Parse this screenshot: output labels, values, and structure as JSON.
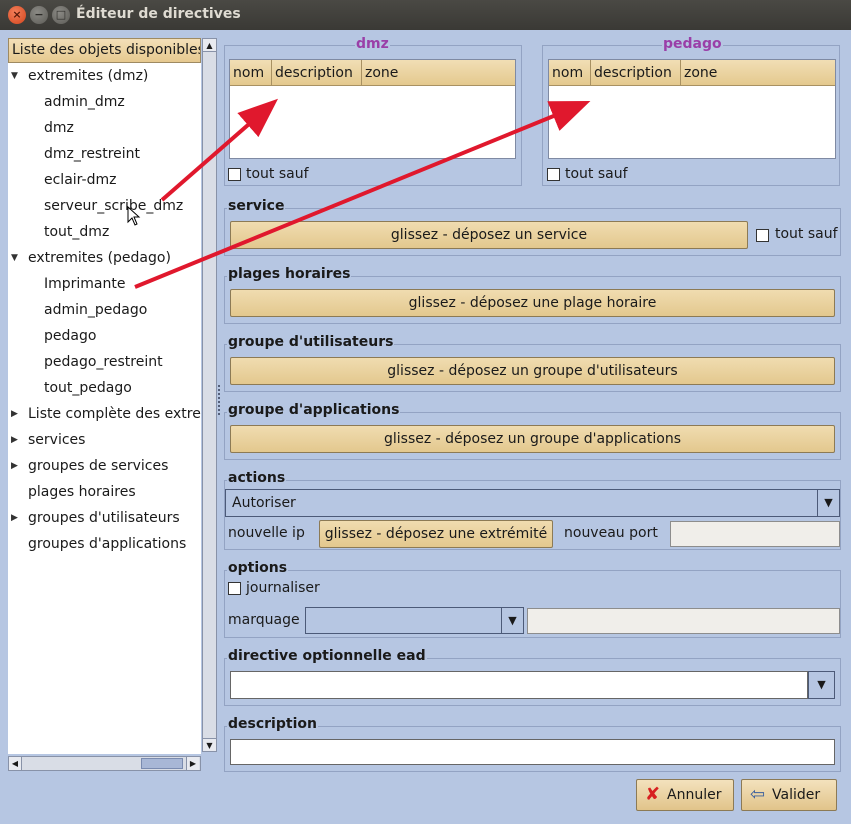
{
  "window": {
    "title": "Éditeur de directives",
    "close": "×",
    "minimize": "−",
    "maximize": "□"
  },
  "tree": {
    "header": "Liste des objets disponibles",
    "groups": [
      {
        "label": "extremites (dmz)",
        "expanded": true,
        "children": [
          "admin_dmz",
          "dmz",
          "dmz_restreint",
          "eclair-dmz",
          "serveur_scribe_dmz",
          "tout_dmz"
        ]
      },
      {
        "label": "extremites (pedago)",
        "expanded": true,
        "children": [
          "Imprimante",
          "admin_pedago",
          "pedago",
          "pedago_restreint",
          "tout_pedago"
        ]
      },
      {
        "label": "Liste complète des extremites",
        "expanded": false,
        "children": []
      },
      {
        "label": "services",
        "expanded": false,
        "children": []
      },
      {
        "label": "groupes de services",
        "expanded": false,
        "children": []
      },
      {
        "label": "plages horaires",
        "expanded": false,
        "children": []
      },
      {
        "label": "groupes d'utilisateurs",
        "expanded": false,
        "children": []
      },
      {
        "label": "groupes d'applications",
        "expanded": false,
        "children": []
      }
    ]
  },
  "source": {
    "title": "dmz",
    "columns": [
      "nom",
      "description",
      "zone"
    ],
    "tout_sauf": "tout sauf"
  },
  "destination": {
    "title": "pedago",
    "columns": [
      "nom",
      "description",
      "zone"
    ],
    "tout_sauf": "tout sauf"
  },
  "service": {
    "label": "service",
    "drop": "glissez - déposez un service",
    "tout_sauf": "tout sauf"
  },
  "plages": {
    "label": "plages horaires",
    "drop": "glissez - déposez une plage horaire"
  },
  "groupe_utilisateurs": {
    "label": "groupe d'utilisateurs",
    "drop": "glissez - déposez un groupe d'utilisateurs"
  },
  "groupe_applications": {
    "label": "groupe d'applications",
    "drop": "glissez - déposez un groupe d'applications"
  },
  "actions": {
    "label": "actions",
    "selected": "Autoriser",
    "nouvelle_ip": "nouvelle ip",
    "drop_extremite": "glissez - déposez une extrémité",
    "nouveau_port": "nouveau port",
    "nouveau_port_value": ""
  },
  "options": {
    "label": "options",
    "journaliser": "journaliser",
    "marquage": "marquage",
    "marquage_selected": "",
    "marquage_value": ""
  },
  "directive_ead": {
    "label": "directive optionnelle ead",
    "value": ""
  },
  "description": {
    "label": "description",
    "value": ""
  },
  "buttons": {
    "annuler": "Annuler",
    "valider": "Valider"
  },
  "colors": {
    "window_bg": "#b6c6e2",
    "header_bg": "#e6c98f",
    "accent_purple": "#9a3fa8",
    "arrow_red": "#e0182d"
  }
}
